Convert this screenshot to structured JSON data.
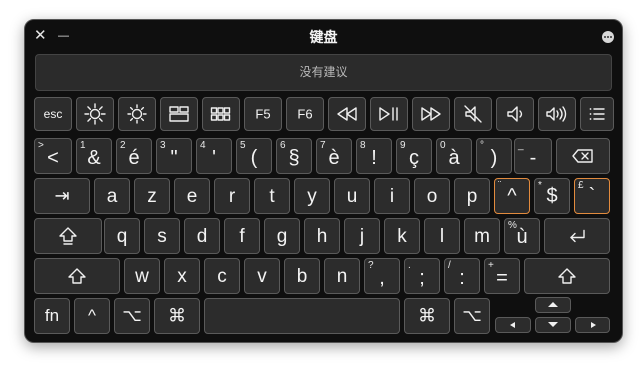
{
  "window": {
    "title": "键盘",
    "close_icon": "✕",
    "minimize_icon": "—",
    "suggestion_text": "没有建议"
  },
  "rows": {
    "function": [
      "esc",
      "brightness-down",
      "brightness-up",
      "mission-control",
      "launchpad",
      "F5",
      "F6",
      "rewind",
      "play-pause",
      "fast-forward",
      "mute",
      "volume-down",
      "volume-up",
      "menu"
    ],
    "fn_labels": {
      "esc": "esc",
      "f5": "F5",
      "f6": "F6"
    },
    "numbers": [
      {
        "main": "<",
        "sec": ">"
      },
      {
        "main": "&",
        "sec": "1"
      },
      {
        "main": "é",
        "sec": "2"
      },
      {
        "main": "\"",
        "sec": "3"
      },
      {
        "main": "'",
        "sec": "4"
      },
      {
        "main": "(",
        "sec": "5"
      },
      {
        "main": "§",
        "sec": "6"
      },
      {
        "main": "è",
        "sec": "7"
      },
      {
        "main": "!",
        "sec": "8"
      },
      {
        "main": "ç",
        "sec": "9"
      },
      {
        "main": "à",
        "sec": "0"
      },
      {
        "main": ")",
        "sec": "°"
      },
      {
        "main": "-",
        "sec": "_"
      }
    ],
    "top": [
      "a",
      "z",
      "e",
      "r",
      "t",
      "y",
      "u",
      "i",
      "o",
      "p"
    ],
    "top_extra": [
      {
        "main": "^",
        "sec": "¨"
      },
      {
        "main": "$",
        "sec": "*"
      },
      {
        "main": "`",
        "sec": "£"
      }
    ],
    "home": [
      "q",
      "s",
      "d",
      "f",
      "g",
      "h",
      "j",
      "k",
      "l",
      "m"
    ],
    "home_extra": {
      "main": "ù",
      "sec": "%"
    },
    "bottom": [
      "w",
      "x",
      "c",
      "v",
      "b",
      "n"
    ],
    "bottom_punct": [
      {
        "main": ",",
        "sec": "?"
      },
      {
        "main": ";",
        "sec": "."
      },
      {
        "main": ":",
        "sec": "/"
      },
      {
        "main": "=",
        "sec": "+"
      }
    ],
    "modifiers": {
      "fn": "fn",
      "control": "^",
      "option": "⌥",
      "command": "⌘",
      "tab": "⇥",
      "enter": "↩"
    }
  },
  "colors": {
    "window_bg": "#0f0f0f",
    "key_bg": "#2c2c2c",
    "key_border": "#5a5a5a",
    "highlight": "#e28b3e"
  }
}
